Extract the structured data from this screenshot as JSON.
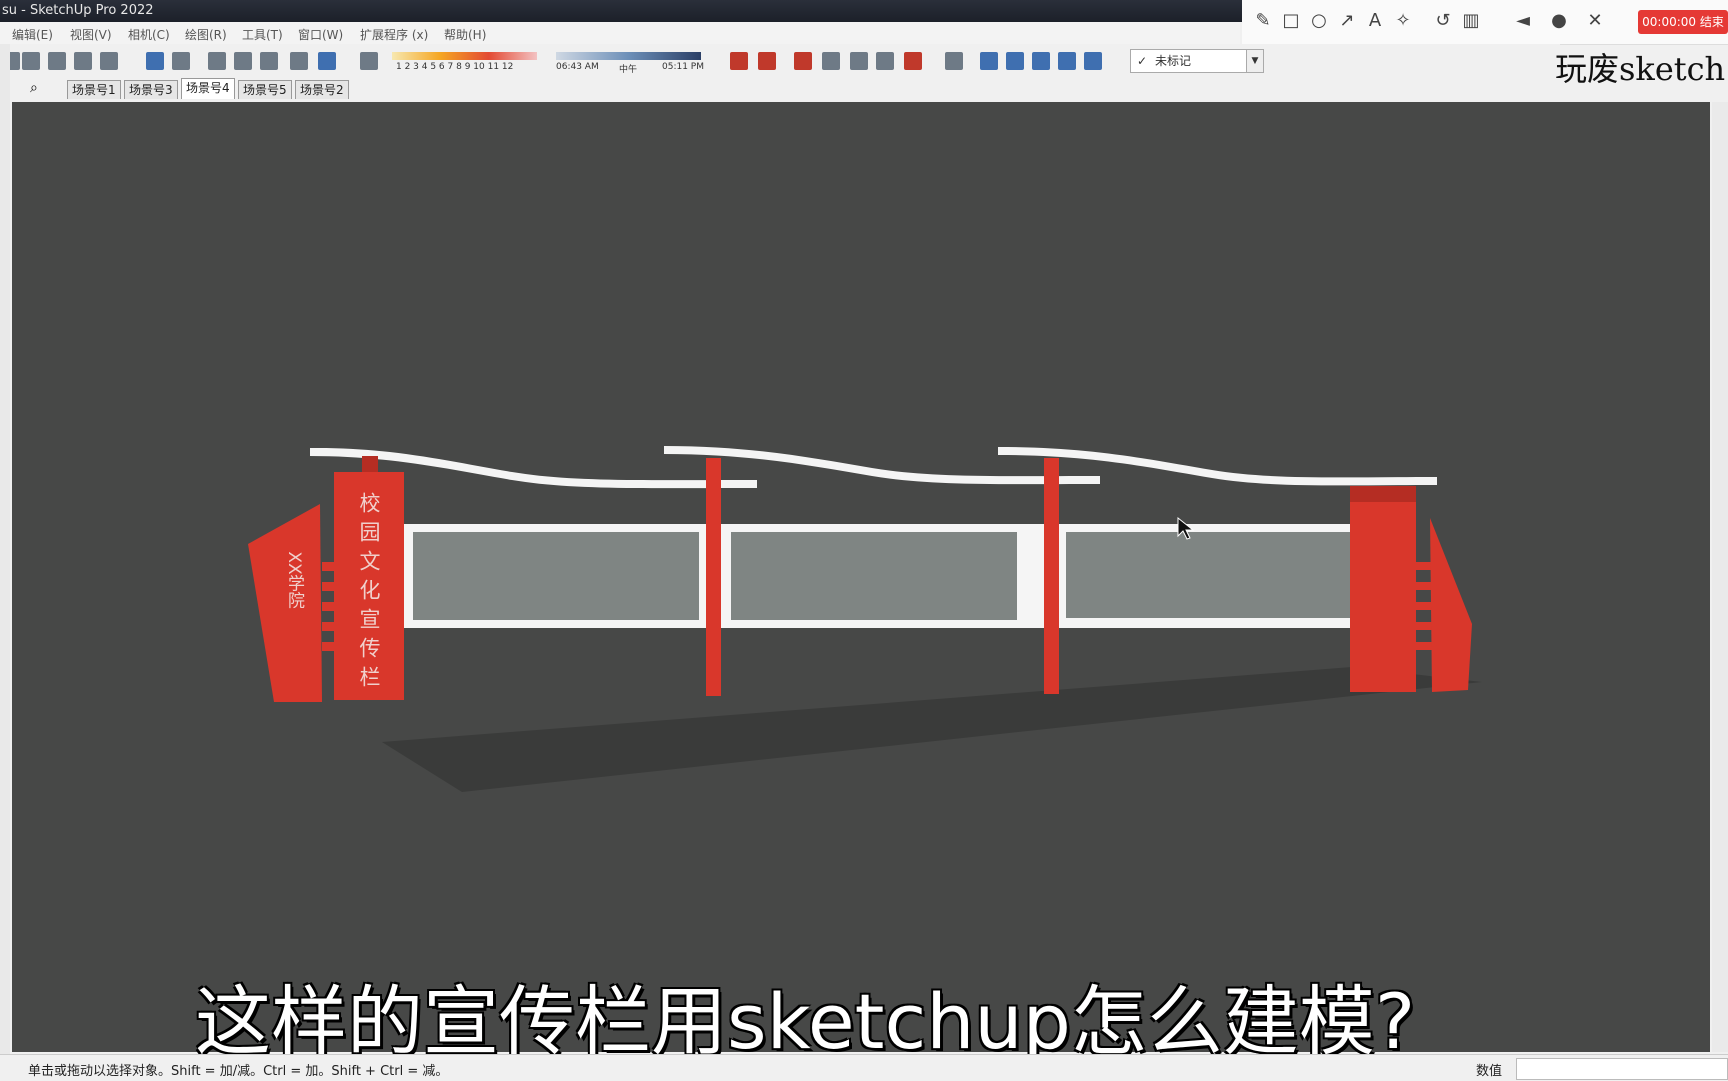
{
  "window": {
    "title": "su - SketchUp Pro 2022"
  },
  "menu": [
    "编辑(E)",
    "视图(V)",
    "相机(C)",
    "绘图(R)",
    "工具(T)",
    "窗口(W)",
    "扩展程序 (x)",
    "帮助(H)"
  ],
  "recorder": {
    "button_label": "00:00:00 结束"
  },
  "shadow": {
    "months": "1 2 3 4 5 6 7 8 9 10 11 12",
    "time_start": "06:43 AM",
    "time_mid": "中午",
    "time_end": "05:11 PM"
  },
  "tag": {
    "selected": "未标记"
  },
  "brand": {
    "text": "玩废sketch"
  },
  "scenes": [
    "场景号1",
    "场景号3",
    "场景号4",
    "场景号5",
    "场景号2"
  ],
  "active_scene": "场景号4",
  "model": {
    "left_panel_text": "校园文化宣传栏",
    "small_panel_text": "XX学院"
  },
  "subtitle": "这样的宣传栏用sketchup怎么建模?",
  "status": {
    "hint": "单击或拖动以选择对象。Shift = 加/减。Ctrl = 加。Shift + Ctrl = 减。",
    "measurements_label": "数值"
  },
  "colors": {
    "viewport": "#474847",
    "frame_red": "#d9372b",
    "board_gray": "#7f8583"
  }
}
